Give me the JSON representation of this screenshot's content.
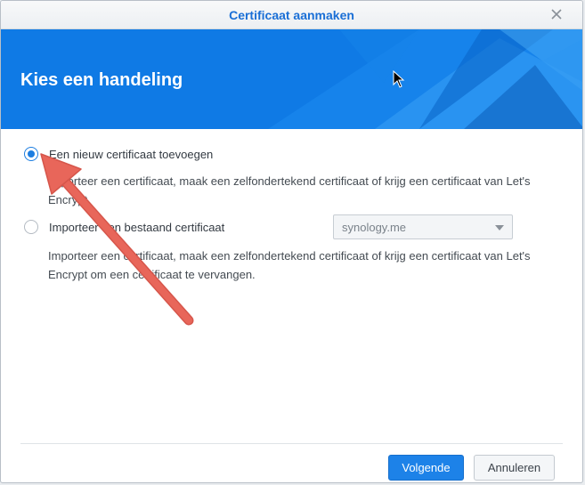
{
  "dialog": {
    "title": "Certificaat aanmaken",
    "close_icon": "close-icon"
  },
  "banner": {
    "heading": "Kies een handeling",
    "accent_color": "#0e7ae6"
  },
  "options": [
    {
      "label": "Een nieuw certificaat toevoegen",
      "checked": true,
      "description": "Importeer een certificaat, maak een zelfondertekend certificaat of krijg een certificaat van Let's Encrypt."
    },
    {
      "label": "Importeer een bestaand certificaat",
      "checked": false,
      "description": "Importeer een certificaat, maak een zelfondertekend certificaat of krijg een certificaat van Let's Encrypt om een certificaat te vervangen.",
      "select_value": "synology.me"
    }
  ],
  "footer": {
    "primary_label": "Volgende",
    "secondary_label": "Annuleren",
    "primary_color": "#1d82e8"
  },
  "annotation": {
    "arrow_color": "#e8665a",
    "icon": "annotation-arrow-icon"
  }
}
